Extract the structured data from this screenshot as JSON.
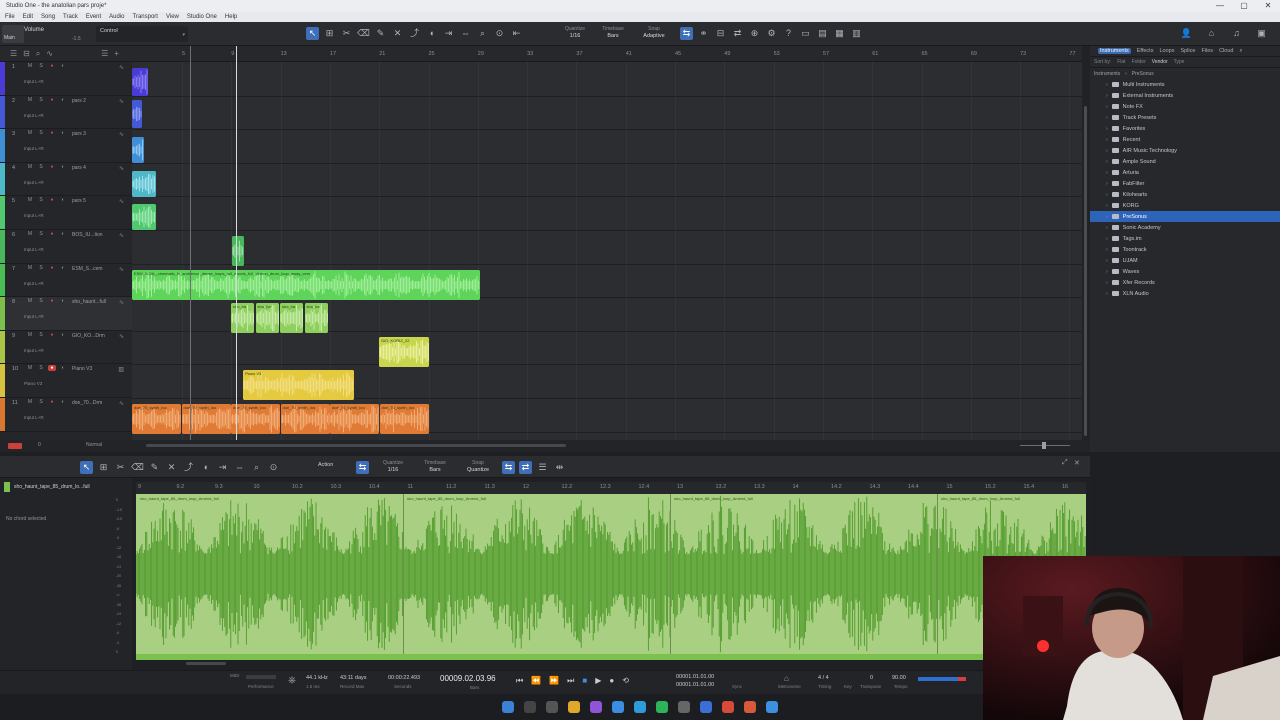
{
  "window": {
    "title": "Studio One - the anatolian pars proje*",
    "controls": [
      "—",
      "▢",
      "✕"
    ]
  },
  "menu": [
    "File",
    "Edit",
    "Song",
    "Track",
    "Event",
    "Audio",
    "Transport",
    "View",
    "Studio One",
    "Help"
  ],
  "toolbar": {
    "main_label": "Main",
    "main_value": "-1.5",
    "volume_label": "Volume",
    "control_label": "Control",
    "quantize": {
      "title": "Quantize",
      "value": "1/16"
    },
    "timebase": {
      "title": "Timebase",
      "value": "Bars"
    },
    "snap": {
      "title": "Snap",
      "value": "Adaptive"
    }
  },
  "ruler": [
    "5",
    "9",
    "13",
    "17",
    "21",
    "25",
    "29",
    "33",
    "37",
    "41",
    "45",
    "49",
    "53",
    "57",
    "61",
    "65",
    "69",
    "73",
    "77"
  ],
  "tracks": [
    {
      "num": "1",
      "name": "",
      "input": "Input L+R",
      "color": "#4a3bd6"
    },
    {
      "num": "2",
      "name": "pars 2",
      "input": "Input L+R",
      "color": "#4459d8"
    },
    {
      "num": "3",
      "name": "pars 3",
      "input": "Input L+R",
      "color": "#3f8fd6"
    },
    {
      "num": "4",
      "name": "pars 4",
      "input": "Input L+R",
      "color": "#4fb8c8"
    },
    {
      "num": "5",
      "name": "pars 5",
      "input": "Input L+R",
      "color": "#4fc870"
    },
    {
      "num": "6",
      "name": "BOS_IU...tion",
      "input": "Input L+R",
      "color": "#49b85a"
    },
    {
      "num": "7",
      "name": "ESM_S...cem",
      "input": "Input L+R",
      "color": "#4bbd55"
    },
    {
      "num": "8",
      "name": "sho_haunt...full",
      "input": "Input L+R",
      "color": "#7cbf4a"
    },
    {
      "num": "9",
      "name": "GIO_KO...Drm",
      "input": "Input L+R",
      "color": "#a8c548"
    },
    {
      "num": "10",
      "name": "Piano V3",
      "input": "Piano V3",
      "midi": "MIDI 1",
      "color": "#d6c23e"
    },
    {
      "num": "11",
      "name": "doe_70...Drm",
      "input": "Input L+R",
      "color": "#d9772e"
    }
  ],
  "clips": {
    "esm": "ESM_SOAL_cinematic_fx_ambience_dense_loops_full_woods_fx2_demon_drum_loop_away_cem",
    "sho": "sho_ha",
    "gio": "GIO_KORIZ_22",
    "piano": "Piano V3",
    "doe": "doe_70_synth_loo"
  },
  "arrange_footer": {
    "mode": "Normal"
  },
  "browser": {
    "tabs": [
      "Instruments",
      "Effects",
      "Loops",
      "Splice",
      "Files",
      "Cloud"
    ],
    "sub": [
      "Sort by:",
      "Flat",
      "Folder",
      "Vendor",
      "Type"
    ],
    "path": [
      "Instruments",
      "PreSonus"
    ],
    "items": [
      {
        "label": "Multi Instruments",
        "sel": false
      },
      {
        "label": "External Instruments",
        "sel": false
      },
      {
        "label": "Note FX",
        "sel": false
      },
      {
        "label": "Track Presets",
        "sel": false
      },
      {
        "label": "Favorites",
        "sel": false
      },
      {
        "label": "Recent",
        "sel": false
      },
      {
        "label": "AIR Music Technology",
        "sel": false
      },
      {
        "label": "Ample Sound",
        "sel": false
      },
      {
        "label": "Arturia",
        "sel": false
      },
      {
        "label": "FabFilter",
        "sel": false
      },
      {
        "label": "Kilohearts",
        "sel": false
      },
      {
        "label": "KORG",
        "sel": false
      },
      {
        "label": "PreSonus",
        "sel": true
      },
      {
        "label": "Sonic Academy",
        "sel": false
      },
      {
        "label": "Tags.im",
        "sel": false
      },
      {
        "label": "Toontrack",
        "sel": false
      },
      {
        "label": "UJAM",
        "sel": false
      },
      {
        "label": "Waves",
        "sel": false
      },
      {
        "label": "Xfer Records",
        "sel": false
      },
      {
        "label": "XLN Audio",
        "sel": false
      }
    ]
  },
  "editor": {
    "track_name": "sho_haunt_tape_85_drum_lo...full",
    "chord_status": "No chord selected",
    "action_label": "Action",
    "quantize": {
      "title": "Quantize",
      "value": "1/16"
    },
    "timebase": {
      "title": "Timebase",
      "value": "Bars"
    },
    "snap": {
      "title": "Snap",
      "value": "Quantize"
    },
    "clip_label": "sho_haunt_tape_85_drum_loop_Amend_full",
    "ruler": [
      "9",
      "9.2",
      "9.3",
      "10",
      "10.2",
      "10.3",
      "10.4",
      "11",
      "11.2",
      "11.3",
      "12",
      "12.2",
      "12.3",
      "12.4",
      "13",
      "13.2",
      "13.3",
      "14",
      "14.2",
      "14.3",
      "14.4",
      "15",
      "15.2",
      "15.4",
      "16"
    ],
    "db_scale": [
      "0",
      "-1.5",
      "-3.5",
      "-6",
      "-9",
      "-12",
      "-18",
      "-24",
      "-30",
      "-36",
      "-∞",
      "-36",
      "-24",
      "-12",
      "-6",
      "-3",
      "0"
    ]
  },
  "transport": {
    "sample_rate": "44.1 kHz",
    "latency": "1.5 ms",
    "record_max": "43:11 days",
    "record_max_label": "Record Max",
    "seconds": "00:00:22.493",
    "seconds_label": "Seconds",
    "position": "00009.02.03.96",
    "position_label": "Bars",
    "loop_start": "00001.01.01.00",
    "loop_end": "00001.01.01.00",
    "sync_label": "Sync",
    "metronome_label": "Metronome",
    "time_sig": "4 / 4",
    "timing_label": "Timing",
    "key_label": "Key",
    "transpose": "0",
    "transpose_label": "Transpose",
    "tempo": "90.00",
    "tempo_label": "Tempo",
    "perf_label": "Performance",
    "midi_label": "MIDI"
  }
}
